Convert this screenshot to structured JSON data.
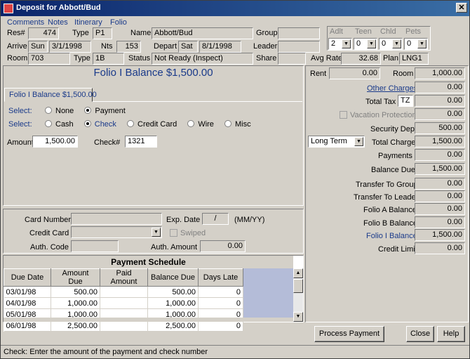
{
  "window": {
    "title": "Deposit for Abbott/Bud",
    "close_glyph": "✕"
  },
  "menu": [
    "Comments",
    "Notes",
    "Itinerary",
    "Folio"
  ],
  "header": {
    "res_label": "Res#",
    "res": "474",
    "type_label": "Type",
    "type": "P1",
    "name_label": "Name",
    "name": "Abbott/Bud",
    "group_label": "Group",
    "group": "",
    "arrive_label": "Arrive",
    "arrive_day": "Sun",
    "arrive_date": "3/1/1998",
    "nts_label": "Nts",
    "nts": "153",
    "depart_label": "Depart",
    "depart_day": "Sat",
    "depart_date": "8/1/1998",
    "leader_label": "Leader",
    "leader": "",
    "room_label": "Room",
    "room": "703",
    "room_type_label": "Type",
    "room_type": "1B",
    "status_label": "Status",
    "status": "Not Ready (Inspect)",
    "share_label": "Share",
    "share": "",
    "avg_rate_label": "Avg Rate",
    "avg_rate": "32.68",
    "plan_label": "Plan",
    "plan": "LNG1",
    "occupancy": {
      "labels": [
        "Adlt",
        "Teen",
        "Chld",
        "Pets"
      ],
      "values": [
        "2",
        "0",
        "0",
        "0"
      ]
    }
  },
  "folio": {
    "heading": "Folio I Balance $1,500.00",
    "tab": "Folio I Balance $1,500.00",
    "select_label": "Select:",
    "select1": [
      "None",
      "Payment"
    ],
    "select1_checked": "Payment",
    "select2": [
      "Cash",
      "Check",
      "Credit Card",
      "Wire",
      "Misc"
    ],
    "select2_checked": "Check",
    "amount_label": "Amount",
    "amount": "1,500.00",
    "check_label": "Check#",
    "check": "1321"
  },
  "card": {
    "number_label": "Card Number",
    "number": "",
    "exp_label": "Exp. Date",
    "exp": "/",
    "exp_hint": "(MM/YY)",
    "cc_label": "Credit Card",
    "cc": "",
    "swiped_label": "Swiped",
    "auth_code_label": "Auth. Code",
    "auth_code": "",
    "auth_amount_label": "Auth. Amount",
    "auth_amount": "0.00"
  },
  "schedule": {
    "title": "Payment Schedule",
    "columns": [
      "Due Date",
      "Amount Due",
      "Paid Amount",
      "Balance Due",
      "Days Late"
    ],
    "rows": [
      [
        "03/01/98",
        "500.00",
        "",
        "500.00",
        "0"
      ],
      [
        "04/01/98",
        "1,000.00",
        "",
        "1,000.00",
        "0"
      ],
      [
        "05/01/98",
        "1,000.00",
        "",
        "1,000.00",
        "0"
      ],
      [
        "06/01/98",
        "2,500.00",
        "",
        "2,500.00",
        "0"
      ]
    ]
  },
  "right": {
    "rent_label": "Rent",
    "rent": "0.00",
    "room_label": "Room",
    "room": "1,000.00",
    "other_label": "Other Charges",
    "other": "0.00",
    "tax_label": "Total Tax",
    "tax_code": "TZ",
    "tax": "0.00",
    "vac_label": "Vacation Protection",
    "vac": "0.00",
    "sec_label": "Security Dep.",
    "sec": "500.00",
    "term": "Long Term",
    "total_label": "Total Charge",
    "total": "1,500.00",
    "payments_label": "Payments",
    "payments": "0.00",
    "balance_label": "Balance Due",
    "balance": "1,500.00",
    "tgroup_label": "Transfer To Group",
    "tgroup": "0.00",
    "tleader_label": "Transfer To Leader",
    "tleader": "0.00",
    "fa_label": "Folio A Balance",
    "fa": "0.00",
    "fb_label": "Folio B Balance",
    "fb": "0.00",
    "fi_label": "Folio I Balance",
    "fi": "1,500.00",
    "credit_label": "Credit Limit",
    "credit": "0.00"
  },
  "buttons": {
    "process": "Process Payment",
    "close": "Close",
    "help": "Help"
  },
  "status_text": "Check: Enter the amount of the payment and check number"
}
